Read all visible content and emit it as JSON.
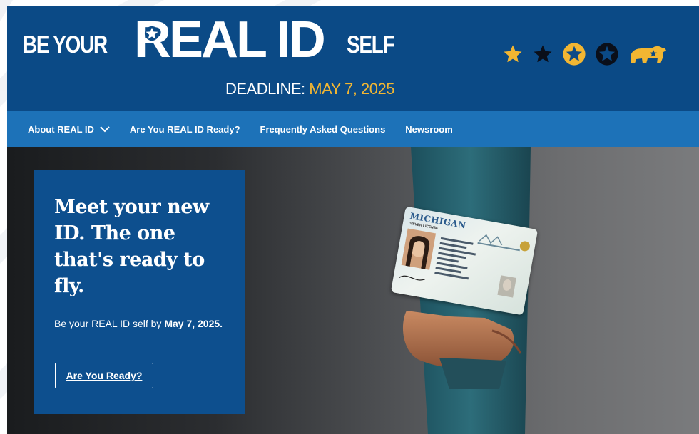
{
  "header": {
    "brand_pre": "BE YOUR",
    "brand_main": "REAL ID",
    "brand_post": "SELF",
    "deadline_label": "DEADLINE:",
    "deadline_date": "MAY 7, 2025",
    "icons": [
      "star-gold-icon",
      "star-black-icon",
      "star-gold-circle-icon",
      "star-black-circle-icon",
      "bear-icon"
    ]
  },
  "nav": {
    "items": [
      {
        "label": "About REAL ID",
        "has_dropdown": true
      },
      {
        "label": "Are You REAL ID Ready?"
      },
      {
        "label": "Frequently Asked Questions"
      },
      {
        "label": "Newsroom"
      }
    ]
  },
  "hero": {
    "title": "Meet your new ID. The one that's ready to fly.",
    "subtitle_prefix": "Be your REAL ID self by ",
    "subtitle_bold": "May 7, 2025.",
    "cta_label": "Are You Ready?",
    "card_state": "MICHIGAN",
    "card_type": "DRIVER LICENSE"
  },
  "colors": {
    "header_bg": "#0b4a86",
    "nav_bg": "#1d72b8",
    "accent_gold": "#f2b632",
    "hero_card_bg": "#0d4f8e"
  }
}
